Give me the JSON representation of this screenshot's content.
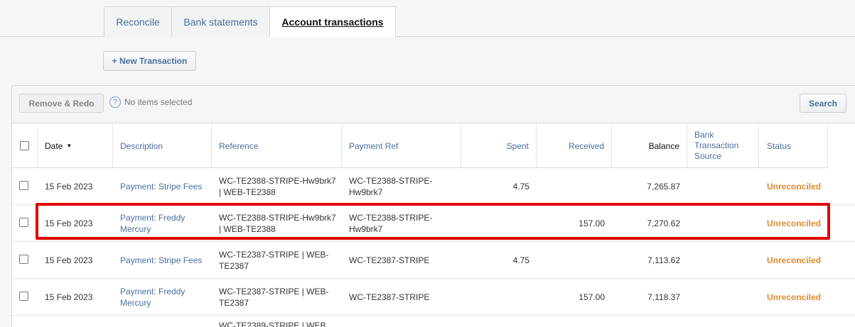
{
  "tabs": [
    {
      "label": "Reconcile"
    },
    {
      "label": "Bank statements"
    },
    {
      "label": "Account transactions"
    }
  ],
  "new_transaction_label": "+ New Transaction",
  "toolbar": {
    "remove_label": "Remove & Redo",
    "help_glyph": "?",
    "selection_text": "No items selected",
    "search_label": "Search"
  },
  "columns": {
    "date": "Date",
    "description": "Description",
    "reference": "Reference",
    "payment_ref": "Payment Ref",
    "spent": "Spent",
    "received": "Received",
    "balance": "Balance",
    "bank_source": "Bank Transaction Source",
    "status": "Status"
  },
  "rows": [
    {
      "date": "15 Feb 2023",
      "description": "Payment: Stripe Fees",
      "reference": "WC-TE2388-STRIPE-Hw9brk7 | WEB-TE2388",
      "payment_ref": "WC-TE2388-STRIPE-Hw9brk7",
      "spent": "4.75",
      "received": "",
      "balance": "7,265.87",
      "status": "Unreconciled"
    },
    {
      "date": "15 Feb 2023",
      "description": "Payment: Freddy Mercury",
      "reference": "WC-TE2388-STRIPE-Hw9brk7 | WEB-TE2388",
      "payment_ref": "WC-TE2388-STRIPE-Hw9brk7",
      "spent": "",
      "received": "157.00",
      "balance": "7,270.62",
      "status": "Unreconciled"
    },
    {
      "date": "15 Feb 2023",
      "description": "Payment: Stripe Fees",
      "reference": "WC-TE2387-STRIPE | WEB-TE2387",
      "payment_ref": "WC-TE2387-STRIPE",
      "spent": "4.75",
      "received": "",
      "balance": "7,113.62",
      "status": "Unreconciled"
    },
    {
      "date": "15 Feb 2023",
      "description": "Payment: Freddy Mercury",
      "reference": "WC-TE2387-STRIPE | WEB-TE2387",
      "payment_ref": "WC-TE2387-STRIPE",
      "spent": "",
      "received": "157.00",
      "balance": "7,118.37",
      "status": "Unreconciled"
    },
    {
      "date": "",
      "description": "",
      "reference": "WC-TE2389-STRIPE | WEB",
      "payment_ref": "",
      "spent": "",
      "received": "",
      "balance": "",
      "status": ""
    }
  ],
  "colors": {
    "link": "#4a6f9c",
    "status_unreconciled": "#e08a2c",
    "highlight": "#e00000"
  }
}
